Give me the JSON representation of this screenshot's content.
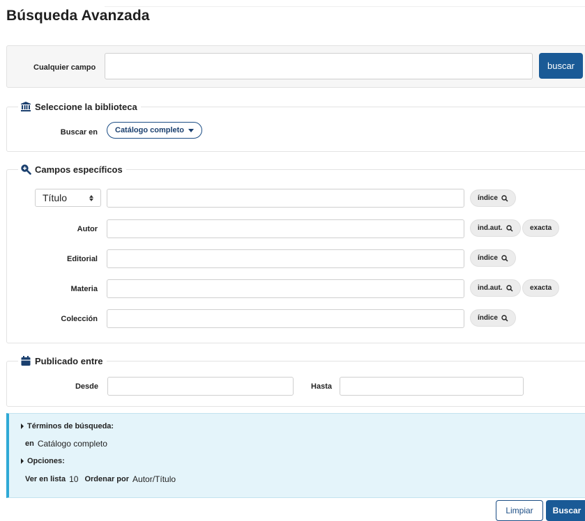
{
  "page": {
    "title": "Búsqueda Avanzada"
  },
  "any_field": {
    "label": "Cualquier campo",
    "value": "",
    "button": "buscar"
  },
  "library": {
    "legend": "Seleccione la biblioteca",
    "icon": "library-icon",
    "search_in_label": "Buscar en",
    "selected": "Catálogo completo"
  },
  "specific": {
    "legend": "Campos específicos",
    "icon": "search-plus-icon",
    "field_select": "Título",
    "rows": [
      {
        "label": "",
        "chips": [
          "índice"
        ]
      },
      {
        "label": "Autor",
        "chips": [
          "ind.aut.",
          "exacta"
        ]
      },
      {
        "label": "Editorial",
        "chips": [
          "índice"
        ]
      },
      {
        "label": "Materia",
        "chips": [
          "ind.aut.",
          "exacta"
        ]
      },
      {
        "label": "Colección",
        "chips": [
          "índice"
        ]
      }
    ]
  },
  "published": {
    "legend": "Publicado entre",
    "icon": "calendar-icon",
    "from_label": "Desde",
    "to_label": "Hasta"
  },
  "summary": {
    "terms_label": "Términos de búsqueda:",
    "in_prefix": "en",
    "in_value": "Catálogo completo",
    "options_label": "Opciones:",
    "list_label": "Ver en lista",
    "list_value": "10",
    "order_label": "Ordenar por",
    "order_value": "Autor/Título"
  },
  "actions": {
    "clear": "Limpiar",
    "submit": "Buscar"
  },
  "colors": {
    "primary": "#1a5a96",
    "summary_bg": "#e4f4fa",
    "summary_accent": "#2fa9d6"
  }
}
